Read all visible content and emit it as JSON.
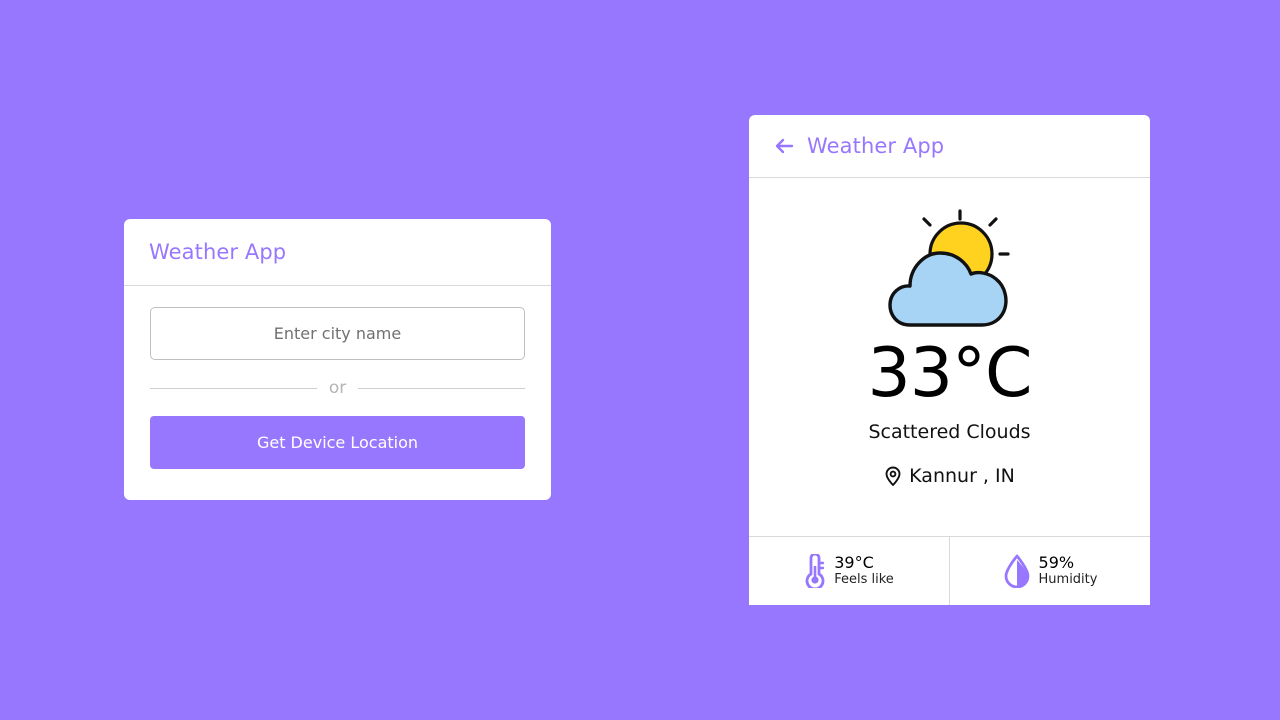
{
  "search_card": {
    "title": "Weather App",
    "input": {
      "placeholder": "Enter city name",
      "value": ""
    },
    "divider_text": "or",
    "location_button_label": "Get Device Location"
  },
  "weather_card": {
    "title": "Weather App",
    "icon": "partly-cloudy-icon",
    "temperature": "33°C",
    "description": "Scattered Clouds",
    "location": "Kannur , IN",
    "feels_like": {
      "value": "39°C",
      "label": "Feels like"
    },
    "humidity": {
      "value": "59%",
      "label": "Humidity"
    }
  },
  "colors": {
    "background": "#9877ff",
    "accent": "#9877ff",
    "sun": "#ffd21f",
    "cloud": "#a7d3f5",
    "card": "#ffffff"
  }
}
